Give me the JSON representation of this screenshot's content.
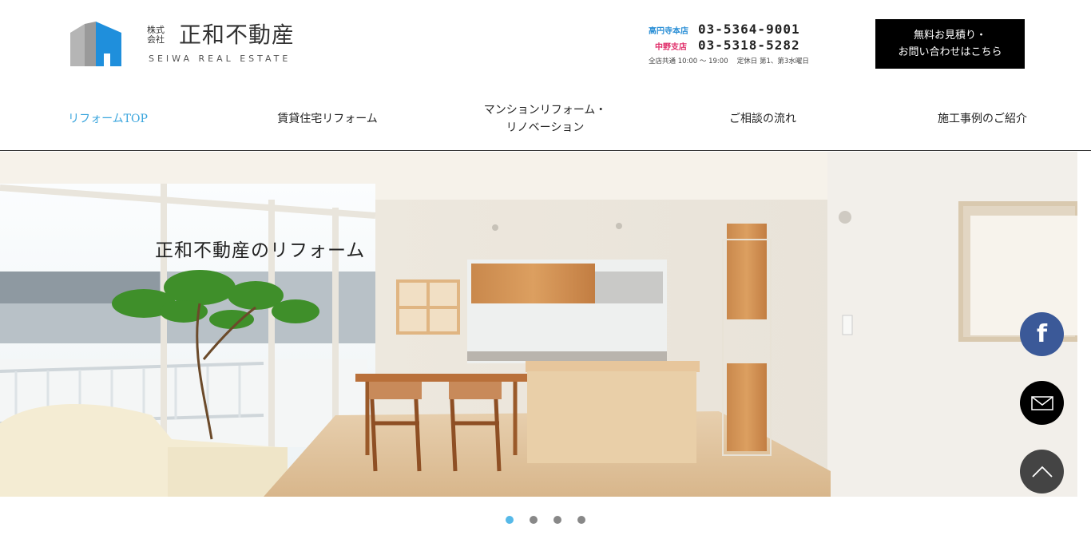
{
  "header": {
    "logo": {
      "kabushiki": "株式\n会社",
      "name": "正和不動産",
      "english": "SEIWA REAL ESTATE"
    },
    "branches": [
      {
        "label": "高円寺本店",
        "phone": "03-5364-9001",
        "color": "#2b8fd6"
      },
      {
        "label": "中野支店",
        "phone": "03-5318-5282",
        "color": "#e0306b"
      }
    ],
    "hours": "全店共通 10:00 〜 19:00　 定休日 第1、第3水曜日",
    "estimate_button": {
      "line1": "無料お見積り・",
      "line2": "お問い合わせはこちら"
    }
  },
  "nav": [
    {
      "label": "リフォームTOP",
      "active": true
    },
    {
      "label": "賃貸住宅リフォーム",
      "active": false
    },
    {
      "label": "マンションリフォーム・",
      "label2": "リノベーション",
      "active": false
    },
    {
      "label": "ご相談の流れ",
      "active": false
    },
    {
      "label": "施工事例のご紹介",
      "active": false
    }
  ],
  "hero": {
    "caption": "正和不動産のリフォーム"
  },
  "floating": {
    "facebook_glyph": "f",
    "mail_icon": "mail-icon",
    "top_icon": "chevron-up-icon"
  },
  "slider": {
    "count": 4,
    "active_index": 0,
    "active_color": "#56b9e8"
  }
}
